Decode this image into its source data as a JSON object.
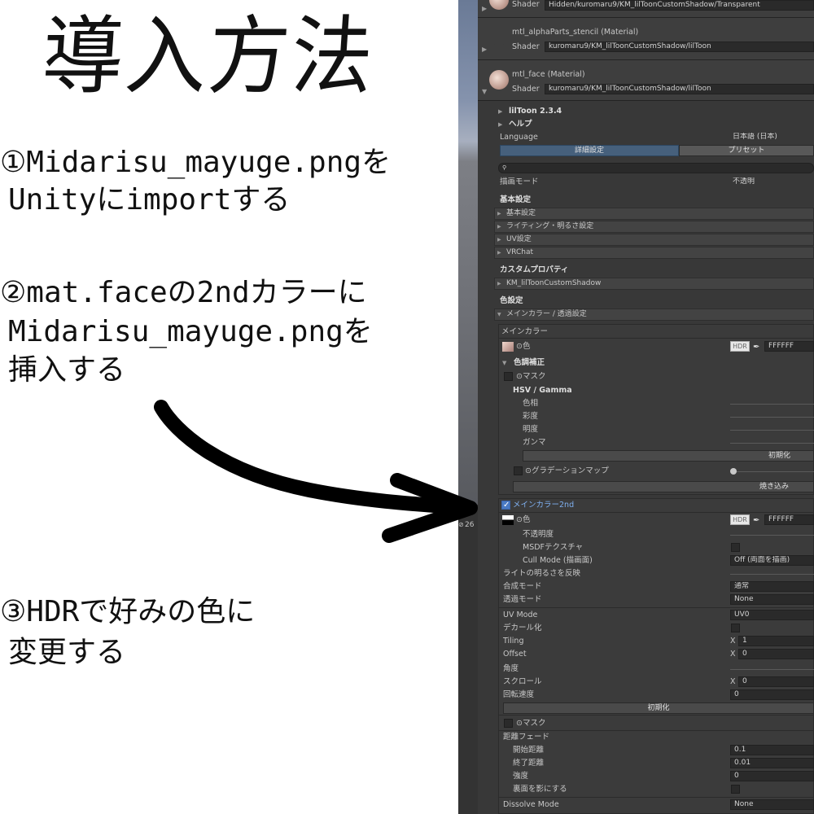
{
  "guide": {
    "title": "導入方法",
    "step1_line1": "①Midarisu_mayuge.pngを",
    "step1_line2": " Unityにimportする",
    "step2_line1": "②mat.faceの2ndカラーに",
    "step2_line2": " Midarisu_mayuge.pngを",
    "step2_line3": " 挿入する",
    "step3_line1": "③HDRで好みの色に",
    "step3_line2": " 変更する"
  },
  "scene": {
    "toolbar_icon": "⋮",
    "count": "26",
    "count_icon": "eye-slash-icon"
  },
  "materials": [
    {
      "shader_label": "Shader",
      "shader": "Hidden/kuromaru9/KM_lilToonCustomShadow/Transparent"
    },
    {
      "name": "mtl_alphaParts_stencil (Material)",
      "shader_label": "Shader",
      "shader": "kuromaru9/KM_lilToonCustomShadow/lilToon"
    },
    {
      "name": "mtl_face (Material)",
      "shader_label": "Shader",
      "shader": "kuromaru9/KM_lilToonCustomShadow/lilToon"
    }
  ],
  "inspector": {
    "liltoon_version": "lilToon 2.3.4",
    "help": "ヘルプ",
    "language_label": "Language",
    "language_value": "日本語 (日本)",
    "tab_detail": "詳細設定",
    "tab_preset": "プリセット",
    "search_icon": "🔍",
    "render_mode_label": "描画モード",
    "render_mode_value": "不透明",
    "basic_header": "基本設定",
    "basic_folds": [
      "基本設定",
      "ライティング・明るさ設定",
      "UV設定",
      "VRChat"
    ],
    "custom_header": "カスタムプロパティ",
    "custom_fold": "KM_lilToonCustomShadow",
    "color_header": "色設定",
    "main_fold": "メインカラー / 透過設定",
    "main_color_title": "メインカラー",
    "color_label": "⊙色",
    "hdr": "HDR",
    "main_hex": "FFFFFF",
    "tone_header": "色調補正",
    "mask_label": "⊙マスク",
    "hsv_header": "HSV / Gamma",
    "hsv_items": [
      "色相",
      "彩度",
      "明度",
      "ガンマ"
    ],
    "reset_btn": "初期化",
    "gradient_label": "⊙グラデーションマップ",
    "bake_btn": "焼き込み",
    "second_title": "メインカラー2nd",
    "second_hex": "FFFFFF",
    "opacity_label": "不透明度",
    "msdf_label": "MSDFテクスチャ",
    "cull_label": "Cull Mode (描画面)",
    "cull_value": "Off (両面を描画)",
    "light_label": "ライトの明るさを反映",
    "blend_label": "合成モード",
    "blend_value": "通常",
    "alpha_label": "透過モード",
    "alpha_value": "None",
    "uvmode_label": "UV Mode",
    "uvmode_value": "UV0",
    "decal_label": "デカール化",
    "tiling_label": "Tiling",
    "tiling_x": "X",
    "tiling_value": "1",
    "offset_label": "Offset",
    "offset_x": "X",
    "offset_value": "0",
    "angle_label": "角度",
    "scroll_label": "スクロール",
    "scroll_x": "X",
    "scroll_value": "0",
    "rotate_label": "回転速度",
    "rotate_value": "0",
    "reset_btn2": "初期化",
    "mask2_label": "⊙マスク",
    "dist_header": "距離フェード",
    "start_label": "開始距離",
    "start_value": "0.1",
    "end_label": "終了距離",
    "end_value": "0.01",
    "strength_label": "強度",
    "strength_value": "0",
    "backface_label": "裏面を影にする",
    "dissolve_label": "Dissolve Mode",
    "dissolve_value": "None"
  }
}
